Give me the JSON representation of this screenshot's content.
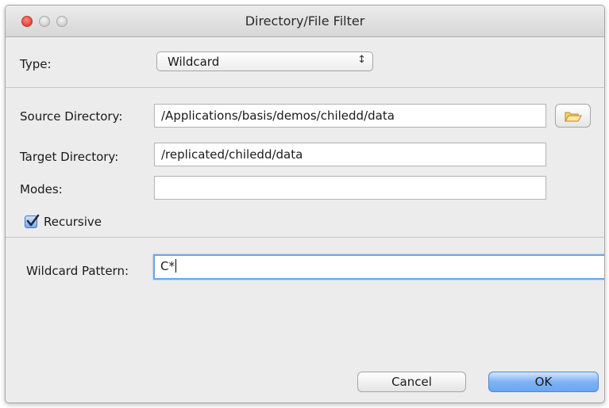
{
  "window": {
    "title": "Directory/File Filter"
  },
  "type": {
    "label": "Type:",
    "selected": "Wildcard",
    "arrows": "⌃⌄"
  },
  "source": {
    "label": "Source Directory:",
    "value": "/Applications/basis/demos/chiledd/data"
  },
  "target": {
    "label": "Target Directory:",
    "value": "/replicated/chiledd/data"
  },
  "modes": {
    "label": "Modes:",
    "value": ""
  },
  "recursive": {
    "label": "Recursive",
    "checked": true
  },
  "wildcard": {
    "label": "Wildcard Pattern:",
    "value": "C*"
  },
  "buttons": {
    "cancel": "Cancel",
    "ok": "OK"
  },
  "colors": {
    "focus_ring": "#6ba4e8",
    "default_button": "#7eb3f3",
    "close_button": "#e0443a"
  }
}
